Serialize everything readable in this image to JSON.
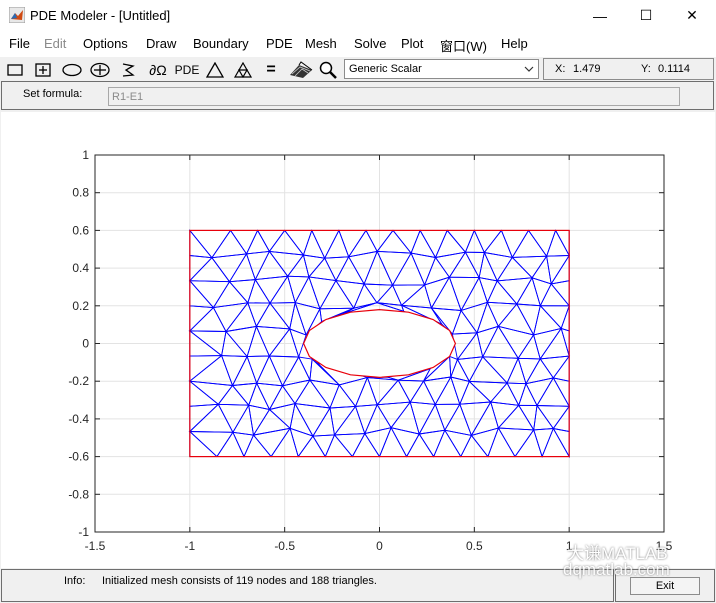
{
  "window": {
    "title": "PDE Modeler - [Untitled]",
    "minimize_glyph": "—",
    "maximize_glyph": "☐",
    "close_glyph": "✕"
  },
  "menu": [
    {
      "label": "File",
      "disabled": false
    },
    {
      "label": "Edit",
      "disabled": true
    },
    {
      "label": "Options",
      "disabled": false
    },
    {
      "label": "Draw",
      "disabled": false
    },
    {
      "label": "Boundary",
      "disabled": false
    },
    {
      "label": "PDE",
      "disabled": false
    },
    {
      "label": "Mesh",
      "disabled": false
    },
    {
      "label": "Solve",
      "disabled": false
    },
    {
      "label": "Plot",
      "disabled": false
    },
    {
      "label": "窗口(W)",
      "disabled": false
    },
    {
      "label": "Help",
      "disabled": false
    }
  ],
  "toolbar": {
    "icons": [
      "rectangle-icon",
      "rectangle-centered-icon",
      "ellipse-icon",
      "ellipse-centered-icon",
      "polygon-icon",
      "boundary-mode-icon",
      "pde-spec-icon",
      "init-mesh-icon",
      "refine-mesh-icon",
      "solve-icon",
      "plot-icon",
      "zoom-icon"
    ],
    "boundary_glyph": "∂Ω",
    "pde_label": "PDE",
    "solve_glyph": "=",
    "application_mode": "Generic Scalar",
    "x_label": "X:",
    "x_value": "1.479",
    "y_label": "Y:",
    "y_value": "0.1114"
  },
  "formula": {
    "label": "Set formula:",
    "value": "R1-E1"
  },
  "chart_data": {
    "type": "mesh",
    "xlim": [
      -1.5,
      1.5
    ],
    "ylim": [
      -1,
      1
    ],
    "xticks": [
      "-1.5",
      "-1",
      "-0.5",
      "0",
      "0.5",
      "1",
      "1.5"
    ],
    "yticks": [
      "1",
      "0.8",
      "0.6",
      "0.4",
      "0.2",
      "0",
      "-0.2",
      "-0.4",
      "-0.6",
      "-0.8",
      "-1"
    ],
    "grid": true,
    "geometry": {
      "rectangle": {
        "xmin": -1,
        "xmax": 1,
        "ymin": -0.6,
        "ymax": 0.6
      },
      "ellipse_hole": {
        "cx": 0,
        "cy": 0,
        "rx": 0.4,
        "ry": 0.18
      }
    },
    "mesh": {
      "nodes": 119,
      "triangles": 188
    },
    "boundary_color": "#e8000b",
    "mesh_color": "#0000ff"
  },
  "status": {
    "info_label": "Info:",
    "info_text": "Initialized mesh consists of 119 nodes and 188 triangles.",
    "exit_label": "Exit"
  },
  "watermark": {
    "line1": "大谦MATLAB",
    "line2": "dqmatlab.com"
  }
}
